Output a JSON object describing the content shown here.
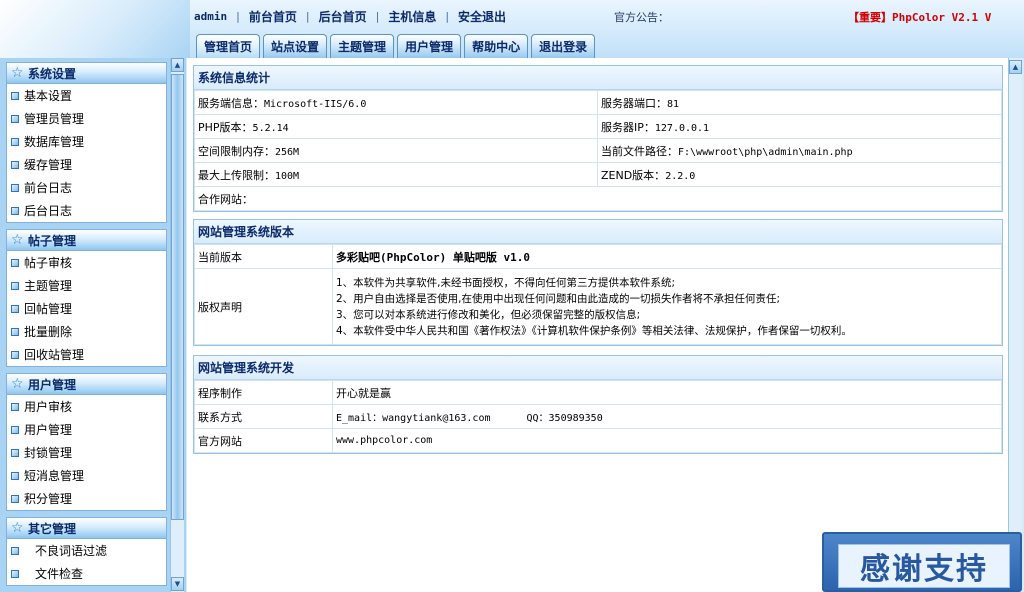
{
  "topnav": {
    "user": "admin",
    "links": [
      "前台首页",
      "后台首页",
      "主机信息",
      "安全退出"
    ],
    "notice_label": "官方公告：",
    "notice_text": "【重要】PhpColor V2.1 V"
  },
  "tabs": [
    "管理首页",
    "站点设置",
    "主题管理",
    "用户管理",
    "帮助中心",
    "退出登录"
  ],
  "sidebar": {
    "groups": [
      {
        "title": "系统设置",
        "items": [
          "基本设置",
          "管理员管理",
          "数据库管理",
          "缓存管理",
          "前台日志",
          "后台日志"
        ]
      },
      {
        "title": "帖子管理",
        "items": [
          "帖子审核",
          "主题管理",
          "回帖管理",
          "批量删除",
          "回收站管理"
        ]
      },
      {
        "title": "用户管理",
        "items": [
          "用户审核",
          "用户管理",
          "封锁管理",
          "短消息管理",
          "积分管理"
        ]
      },
      {
        "title": "其它管理",
        "items": [
          "不良词语过滤",
          "文件检查"
        ]
      }
    ]
  },
  "sysinfo": {
    "title": "系统信息统计",
    "rows": [
      [
        "服务端信息：",
        "Microsoft-IIS/6.0",
        "服务器端口：",
        "81"
      ],
      [
        "PHP版本：",
        "5.2.14",
        "服务器IP：",
        "127.0.0.1"
      ],
      [
        "空间限制内存：",
        "256M",
        "当前文件路径：",
        "F:\\wwwroot\\php\\admin\\main.php"
      ],
      [
        "最大上传限制：",
        "100M",
        "ZEND版本：",
        "2.2.0"
      ]
    ],
    "partner_label": "合作网站："
  },
  "version": {
    "title": "网站管理系统版本",
    "current_label": "当前版本",
    "current_value": "多彩贴吧(PhpColor) 单贴吧版 v1.0",
    "license_label": "版权声明",
    "license_lines": [
      "1、本软件为共享软件,未经书面授权，不得向任何第三方提供本软件系统;",
      "2、用户自由选择是否使用,在使用中出现任何问题和由此造成的一切损失作者将不承担任何责任;",
      "3、您可以对本系统进行修改和美化，但必须保留完整的版权信息;",
      "4、本软件受中华人民共和国《著作权法》《计算机软件保护条例》等相关法律、法规保护，作者保留一切权利。"
    ]
  },
  "dev": {
    "title": "网站管理系统开发",
    "author_label": "程序制作",
    "author_value": "开心就是赢",
    "contact_label": "联系方式",
    "email": "E_mail：wangytiank@163.com",
    "qq": "QQ：350989350",
    "site_label": "官方网站",
    "site_value": "www.phpcolor.com"
  },
  "thanks_banner": "感谢支持"
}
